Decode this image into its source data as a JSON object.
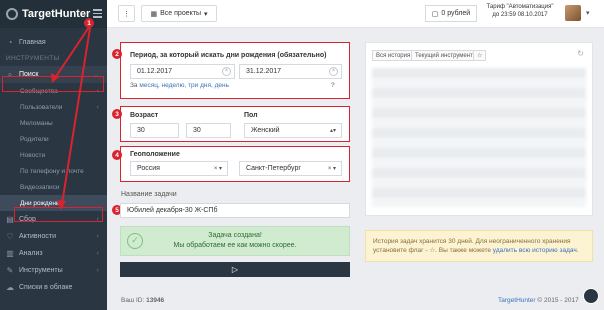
{
  "app": {
    "name": "TargetHunter"
  },
  "sidebar": {
    "items": [
      {
        "label": "Главная",
        "icon": "home-icon"
      },
      {
        "label": "Поиск",
        "icon": "search-icon"
      },
      {
        "label": "Сбор",
        "icon": "collect-icon"
      },
      {
        "label": "Активности",
        "icon": "heart-icon"
      },
      {
        "label": "Анализ",
        "icon": "chart-icon"
      },
      {
        "label": "Инструменты",
        "icon": "wrench-icon"
      },
      {
        "label": "Списки в облаке",
        "icon": "cloud-icon"
      }
    ],
    "section_label": "ИНСТРУМЕНТЫ",
    "search_sub": [
      "Сообщества",
      "Пользователи",
      "Меломаны",
      "Родители",
      "Новости",
      "По телефону и почте",
      "Видеозаписи",
      "Дни рождения"
    ]
  },
  "topbar": {
    "menu_icon": "dots-icon",
    "projects": "Все проекты",
    "balance": "0 рублей",
    "tariff_line1": "Тариф \"Автоматизация\"",
    "tariff_line2": "до 23:59 08.10.2017"
  },
  "form": {
    "period_label": "Период, за который искать дни рождения (обязательно)",
    "date_from": "01.12.2017",
    "date_to": "31.12.2017",
    "quick_prefix": "За",
    "quick_links": "месяц, неделю, три дня, день",
    "help": "?",
    "age_label": "Возраст",
    "age_from": "30",
    "age_to": "30",
    "sex_label": "Пол",
    "sex_value": "Женский",
    "geo_label": "Геоположение",
    "country": "Россия",
    "city": "Санкт-Петербург",
    "task_label": "Название задачи",
    "task_value": "Юбилей декабря-30 Ж-СПб"
  },
  "badges": [
    "1",
    "2",
    "3",
    "4",
    "5"
  ],
  "success": {
    "title": "Задача создана!",
    "text": "Мы обработаем ее как можно скорее."
  },
  "history": {
    "tab1": "Вся история",
    "tab2": "Текущий инструмент",
    "star": "☆"
  },
  "info": {
    "text": "История задач хранится 30 дней. Для неограниченного хранения установите флаг - ☆. Вы также можете",
    "link": "удалить всю историю задач."
  },
  "footer": {
    "id_label": "Ваш ID:",
    "id_value": "13946",
    "brand": "TargetHunter",
    "copy": "© 2015 - 2017"
  },
  "colors": {
    "accent": "#d9232e",
    "sidebar": "#2b3643",
    "link": "#3b73b9"
  }
}
